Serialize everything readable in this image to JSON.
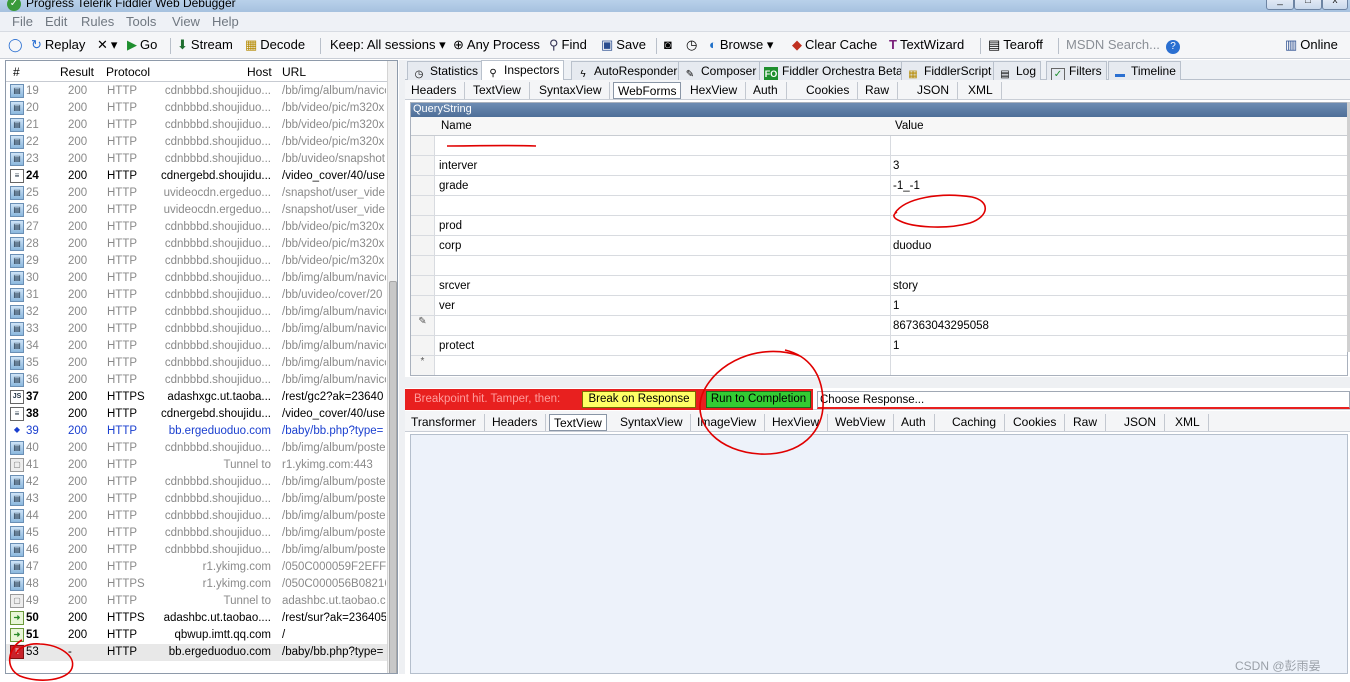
{
  "window": {
    "title": "Progress Telerik Fiddler Web Debugger"
  },
  "menu": [
    "File",
    "Edit",
    "Rules",
    "Tools",
    "View",
    "Help"
  ],
  "toolbar": {
    "replay": "Replay",
    "go": "Go",
    "stream": "Stream",
    "decode": "Decode",
    "keep": "Keep: All sessions",
    "any_process": "Any Process",
    "find": "Find",
    "save": "Save",
    "browse": "Browse",
    "clear_cache": "Clear Cache",
    "textwizard": "TextWizard",
    "tearoff": "Tearoff",
    "msdn_search": "MSDN Search...",
    "online": "Online"
  },
  "sessions": {
    "columns": {
      "num": "#",
      "result": "Result",
      "protocol": "Protocol",
      "host": "Host",
      "url": "URL"
    },
    "rows": [
      {
        "num": "19",
        "result": "200",
        "protocol": "HTTP",
        "host": "cdnbbbd.shoujiduo...",
        "url": "/bb/img/album/navico",
        "style": "dim",
        "icon": "image"
      },
      {
        "num": "20",
        "result": "200",
        "protocol": "HTTP",
        "host": "cdnbbbd.shoujiduo...",
        "url": "/bb/video/pic/m320x",
        "style": "dim",
        "icon": "image"
      },
      {
        "num": "21",
        "result": "200",
        "protocol": "HTTP",
        "host": "cdnbbbd.shoujiduo...",
        "url": "/bb/video/pic/m320x",
        "style": "dim",
        "icon": "image"
      },
      {
        "num": "22",
        "result": "200",
        "protocol": "HTTP",
        "host": "cdnbbbd.shoujiduo...",
        "url": "/bb/video/pic/m320x",
        "style": "dim",
        "icon": "image"
      },
      {
        "num": "23",
        "result": "200",
        "protocol": "HTTP",
        "host": "cdnbbbd.shoujiduo...",
        "url": "/bb/uvideo/snapshot",
        "style": "dim",
        "icon": "image"
      },
      {
        "num": "24",
        "result": "200",
        "protocol": "HTTP",
        "host": "cdnergebd.shoujidu...",
        "url": "/video_cover/40/use",
        "style": "bold",
        "icon": "doc"
      },
      {
        "num": "25",
        "result": "200",
        "protocol": "HTTP",
        "host": "uvideocdn.ergeduo...",
        "url": "/snapshot/user_vide",
        "style": "dim",
        "icon": "image"
      },
      {
        "num": "26",
        "result": "200",
        "protocol": "HTTP",
        "host": "uvideocdn.ergeduo...",
        "url": "/snapshot/user_vide",
        "style": "dim",
        "icon": "image"
      },
      {
        "num": "27",
        "result": "200",
        "protocol": "HTTP",
        "host": "cdnbbbd.shoujiduo...",
        "url": "/bb/video/pic/m320x",
        "style": "dim",
        "icon": "image"
      },
      {
        "num": "28",
        "result": "200",
        "protocol": "HTTP",
        "host": "cdnbbbd.shoujiduo...",
        "url": "/bb/video/pic/m320x",
        "style": "dim",
        "icon": "image"
      },
      {
        "num": "29",
        "result": "200",
        "protocol": "HTTP",
        "host": "cdnbbbd.shoujiduo...",
        "url": "/bb/video/pic/m320x",
        "style": "dim",
        "icon": "image"
      },
      {
        "num": "30",
        "result": "200",
        "protocol": "HTTP",
        "host": "cdnbbbd.shoujiduo...",
        "url": "/bb/img/album/navico",
        "style": "dim",
        "icon": "image"
      },
      {
        "num": "31",
        "result": "200",
        "protocol": "HTTP",
        "host": "cdnbbbd.shoujiduo...",
        "url": "/bb/uvideo/cover/20",
        "style": "dim",
        "icon": "image"
      },
      {
        "num": "32",
        "result": "200",
        "protocol": "HTTP",
        "host": "cdnbbbd.shoujiduo...",
        "url": "/bb/img/album/navico",
        "style": "dim",
        "icon": "image"
      },
      {
        "num": "33",
        "result": "200",
        "protocol": "HTTP",
        "host": "cdnbbbd.shoujiduo...",
        "url": "/bb/img/album/navico",
        "style": "dim",
        "icon": "image"
      },
      {
        "num": "34",
        "result": "200",
        "protocol": "HTTP",
        "host": "cdnbbbd.shoujiduo...",
        "url": "/bb/img/album/navico",
        "style": "dim",
        "icon": "image"
      },
      {
        "num": "35",
        "result": "200",
        "protocol": "HTTP",
        "host": "cdnbbbd.shoujiduo...",
        "url": "/bb/img/album/navico",
        "style": "dim",
        "icon": "image"
      },
      {
        "num": "36",
        "result": "200",
        "protocol": "HTTP",
        "host": "cdnbbbd.shoujiduo...",
        "url": "/bb/img/album/navico",
        "style": "dim",
        "icon": "image"
      },
      {
        "num": "37",
        "result": "200",
        "protocol": "HTTPS",
        "host": "adashxgc.ut.taoba...",
        "url": "/rest/gc2?ak=23640",
        "style": "bold",
        "icon": "js"
      },
      {
        "num": "38",
        "result": "200",
        "protocol": "HTTP",
        "host": "cdnergebd.shoujidu...",
        "url": "/video_cover/40/use",
        "style": "bold",
        "icon": "doc"
      },
      {
        "num": "39",
        "result": "200",
        "protocol": "HTTP",
        "host": "bb.ergeduoduo.com",
        "url": "/baby/bb.php?type=",
        "style": "blue",
        "icon": "arrows"
      },
      {
        "num": "40",
        "result": "200",
        "protocol": "HTTP",
        "host": "cdnbbbd.shoujiduo...",
        "url": "/bb/img/album/poste",
        "style": "dim",
        "icon": "image"
      },
      {
        "num": "41",
        "result": "200",
        "protocol": "HTTP",
        "host": "Tunnel to",
        "url": "r1.ykimg.com:443",
        "style": "dim",
        "icon": "lock"
      },
      {
        "num": "42",
        "result": "200",
        "protocol": "HTTP",
        "host": "cdnbbbd.shoujiduo...",
        "url": "/bb/img/album/poste",
        "style": "dim",
        "icon": "image"
      },
      {
        "num": "43",
        "result": "200",
        "protocol": "HTTP",
        "host": "cdnbbbd.shoujiduo...",
        "url": "/bb/img/album/poste",
        "style": "dim",
        "icon": "image"
      },
      {
        "num": "44",
        "result": "200",
        "protocol": "HTTP",
        "host": "cdnbbbd.shoujiduo...",
        "url": "/bb/img/album/poste",
        "style": "dim",
        "icon": "image"
      },
      {
        "num": "45",
        "result": "200",
        "protocol": "HTTP",
        "host": "cdnbbbd.shoujiduo...",
        "url": "/bb/img/album/poste",
        "style": "dim",
        "icon": "image"
      },
      {
        "num": "46",
        "result": "200",
        "protocol": "HTTP",
        "host": "cdnbbbd.shoujiduo...",
        "url": "/bb/img/album/poste",
        "style": "dim",
        "icon": "image"
      },
      {
        "num": "47",
        "result": "200",
        "protocol": "HTTP",
        "host": "r1.ykimg.com",
        "url": "/050C000059F2EFF3",
        "style": "dim",
        "icon": "image"
      },
      {
        "num": "48",
        "result": "200",
        "protocol": "HTTPS",
        "host": "r1.ykimg.com",
        "url": "/050C000056B08216",
        "style": "dim",
        "icon": "image"
      },
      {
        "num": "49",
        "result": "200",
        "protocol": "HTTP",
        "host": "Tunnel to",
        "url": "adashbc.ut.taobao.c",
        "style": "dim",
        "icon": "lock"
      },
      {
        "num": "50",
        "result": "200",
        "protocol": "HTTPS",
        "host": "adashbc.ut.taobao....",
        "url": "/rest/sur?ak=236405",
        "style": "bold",
        "icon": "green-arrow"
      },
      {
        "num": "51",
        "result": "200",
        "protocol": "HTTP",
        "host": "qbwup.imtt.qq.com",
        "url": "/",
        "style": "bold",
        "icon": "green-arrow"
      },
      {
        "num": "53",
        "result": "-",
        "protocol": "HTTP",
        "host": "bb.ergeduoduo.com",
        "url": "/baby/bb.php?type=",
        "style": "sel",
        "icon": "breakpoint"
      }
    ]
  },
  "tabs": {
    "top": [
      "Statistics",
      "Inspectors",
      "AutoResponder",
      "Composer",
      "Fiddler Orchestra Beta",
      "FiddlerScript",
      "Log",
      "Filters",
      "Timeline"
    ],
    "request": [
      "Headers",
      "TextView",
      "SyntaxView",
      "WebForms",
      "HexView",
      "Auth",
      "Cookies",
      "Raw",
      "JSON",
      "XML"
    ]
  },
  "querystring": {
    "caption": "QueryString",
    "col_name": "Name",
    "col_value": "Value",
    "rows": [
      {
        "name": "",
        "value": ""
      },
      {
        "name": "interver",
        "value": "3"
      },
      {
        "name": "grade",
        "value": "-1_-1"
      },
      {
        "name": "",
        "value": ""
      },
      {
        "name": "prod",
        "value": ""
      },
      {
        "name": "corp",
        "value": "duoduo"
      },
      {
        "name": "",
        "value": ""
      },
      {
        "name": "srcver",
        "value": "story"
      },
      {
        "name": "ver",
        "value": "1"
      },
      {
        "name": "",
        "value": "867363043295058"
      },
      {
        "name": "protect",
        "value": "1"
      },
      {
        "name": "",
        "value": ""
      }
    ]
  },
  "breakpoint": {
    "label": "Breakpoint hit. Tamper, then:",
    "break_on_response": "Break on Response",
    "run_to_completion": "Run to Completion",
    "choose_response": "Choose Response..."
  },
  "response_tabs": [
    "Transformer",
    "Headers",
    "TextView",
    "SyntaxView",
    "ImageView",
    "HexView",
    "WebView",
    "Auth",
    "Caching",
    "Cookies",
    "Raw",
    "JSON",
    "XML"
  ],
  "watermark": "CSDN @彭雨晏",
  "colors": {
    "breakpoint_red": "#e8201f",
    "break_btn": "#ffff66",
    "run_btn": "#33cc33",
    "annotation": "#e00000"
  }
}
